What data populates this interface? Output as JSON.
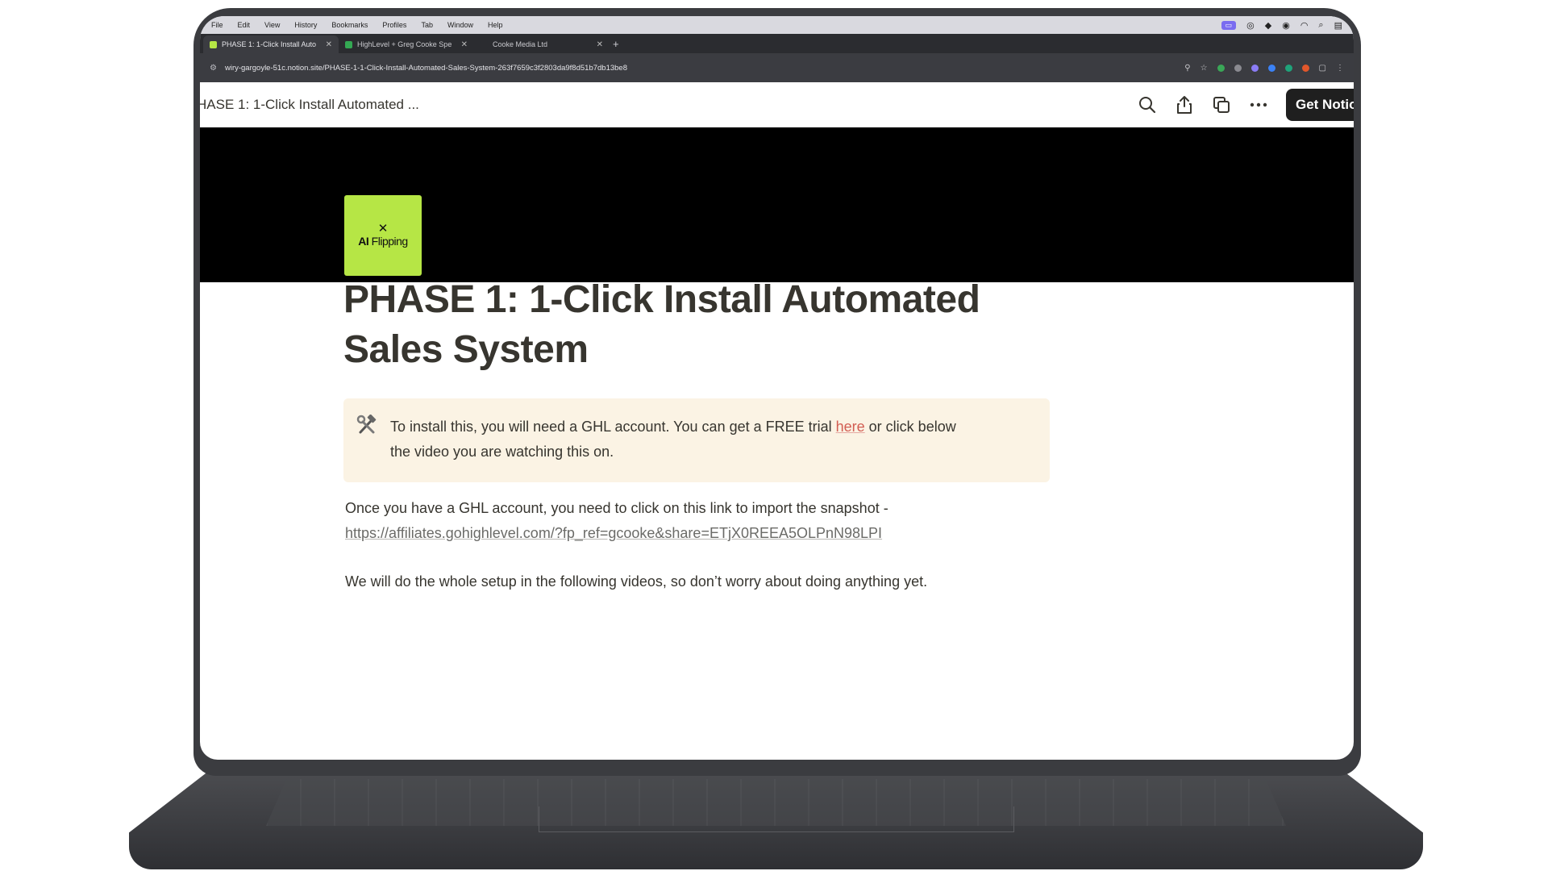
{
  "menubar": {
    "items": [
      "File",
      "Edit",
      "View",
      "History",
      "Bookmarks",
      "Profiles",
      "Tab",
      "Window",
      "Help"
    ]
  },
  "tabs": [
    {
      "title": "PHASE 1: 1-Click Install Auto",
      "favicon_color": "#b6e645",
      "active": true
    },
    {
      "title": "HighLevel + Greg Cooke Spe",
      "favicon_color": "#34a853",
      "active": false
    },
    {
      "title": "Cooke Media Ltd",
      "favicon_color": "#2b2c30",
      "active": false
    }
  ],
  "address_bar": {
    "url": "wiry-gargoyle-51c.notion.site/PHASE-1-1-Click-Install-Automated-Sales-System-263f7659c3f2803da9f8d51b7db13be8"
  },
  "notion_header": {
    "breadcrumb": "HASE 1: 1-Click Install Automated ...",
    "get_notion_label": "Get Notion"
  },
  "page_icon": {
    "logo_text_bold": "AI",
    "logo_text_rest": " Flipping",
    "color": "#b6e645"
  },
  "page": {
    "title_line1": "PHASE 1: 1-Click Install Automated",
    "title_line2": "Sales System",
    "callout": {
      "text_before": "To install this, you will need a GHL account. You can get a FREE trial ",
      "link_text": "here",
      "text_after": " or click below",
      "text_line2": "the video you are watching this on.",
      "icon": "hammer-and-wrench-icon"
    },
    "para1_text": "Once you have a GHL account, you need to click on this link to import the snapshot -",
    "para1_link": "https://affiliates.gohighlevel.com/?fp_ref=gcooke&share=ETjX0REEA5OLPnN98LPI",
    "para2_text": "We will do the whole setup in the following videos, so don’t worry about doing anything yet."
  }
}
